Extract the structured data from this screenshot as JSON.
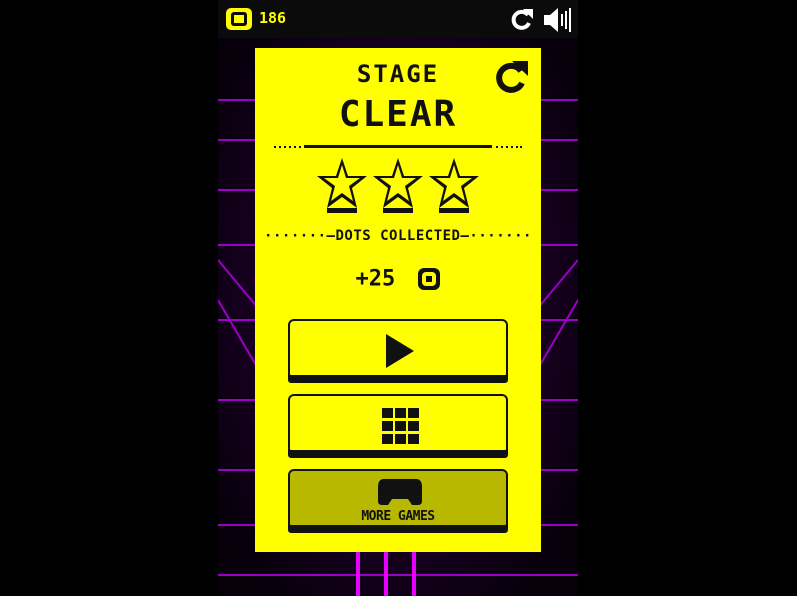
{
  "hud": {
    "coin_count": "186",
    "icons": [
      "coin-icon",
      "restart-icon",
      "sound-icon"
    ]
  },
  "result_panel": {
    "title_line1": "STAGE",
    "title_line2": "CLEAR",
    "stars_earned": 3,
    "stars_total": 3,
    "section_label": "DOTS COLLECTED",
    "reward": "+25",
    "reward_icon": "dot-token-icon",
    "buttons": {
      "play_icon": "play-icon",
      "levels_icon": "grid-icon",
      "more_games_label": "MORE GAMES",
      "more_games_icon": "gamepad-icon"
    }
  },
  "colors": {
    "panel": "#ffff00",
    "button_dim": "#b8b800",
    "ink": "#111111",
    "neon_grid": "#cc00ff",
    "background": "#07000b"
  }
}
